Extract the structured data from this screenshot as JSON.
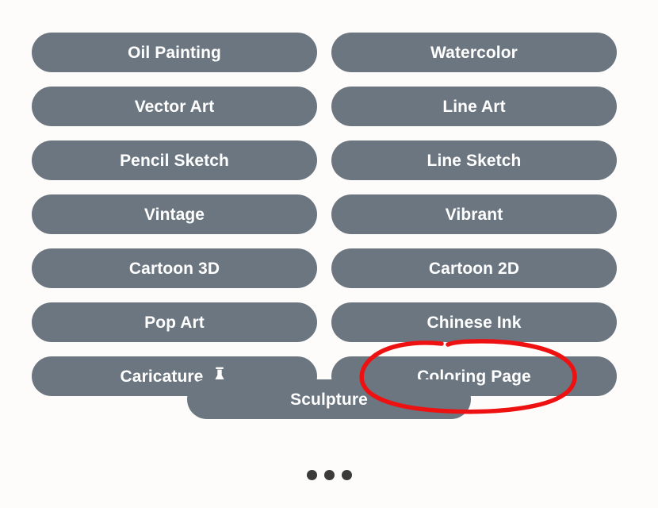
{
  "screen": {
    "name": "style-picker",
    "background_color": "#fdfcfa",
    "chip_color": "#6b7680",
    "chip_text_color": "#ffffff",
    "annotation_color": "#ee1111"
  },
  "styles": [
    {
      "label": "Oil Painting",
      "icon": null
    },
    {
      "label": "Watercolor",
      "icon": null
    },
    {
      "label": "Vector Art",
      "icon": null
    },
    {
      "label": "Line Art",
      "icon": null
    },
    {
      "label": "Pencil Sketch",
      "icon": null
    },
    {
      "label": "Line Sketch",
      "icon": null
    },
    {
      "label": "Vintage",
      "icon": null
    },
    {
      "label": "Vibrant",
      "icon": null
    },
    {
      "label": "Cartoon 3D",
      "icon": null
    },
    {
      "label": "Cartoon 2D",
      "icon": null
    },
    {
      "label": "Pop Art",
      "icon": null
    },
    {
      "label": "Chinese Ink",
      "icon": null
    },
    {
      "label": "Caricature",
      "icon": "flask-icon"
    },
    {
      "label": "Coloring Page",
      "icon": null
    }
  ],
  "full_width_style": {
    "label": "Sculpture",
    "icon": null
  },
  "pager": {
    "dot_count": 3,
    "dots": [
      "page-dot-1",
      "page-dot-2",
      "page-dot-3"
    ]
  },
  "annotation": {
    "type": "hand-drawn-ellipse",
    "color": "#ee1111",
    "targets": "Coloring Page"
  }
}
